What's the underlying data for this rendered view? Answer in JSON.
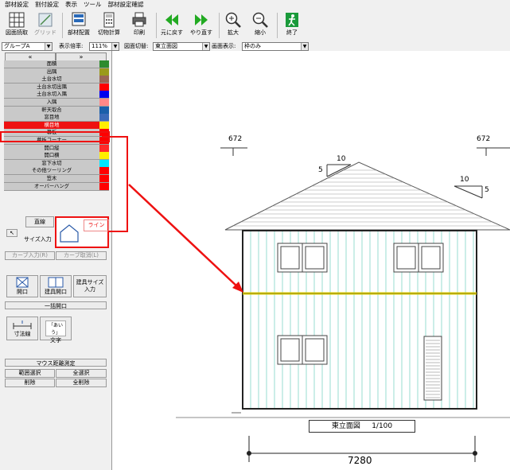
{
  "menu": [
    "部材設定",
    "割付設定",
    "表示",
    "ツール",
    "部材設定確認"
  ],
  "toolbar": {
    "load_plan": "図面読取",
    "grid": "グリッド",
    "member_place": "部材配置",
    "cut_calc": "切物計算",
    "print": "印刷",
    "undo": "元に戻す",
    "redo": "やり直す",
    "zoom_in": "拡大",
    "zoom_out": "縮小",
    "exit": "終了"
  },
  "controls": {
    "group_value": "グループA",
    "scale_label": "表示倍率:",
    "scale_value": "111%",
    "drawing_switch_label": "図面切替:",
    "drawing_switch_value": "東立面図",
    "screen_display_label": "画面表示:",
    "screen_display_value": "枠のみ"
  },
  "sidebar": {
    "prev": "«",
    "next": "»",
    "items": [
      {
        "label": "面積",
        "color": "#2e8b2e",
        "selected": false
      },
      {
        "label": "出隅",
        "color": "#9a9a1a",
        "selected": false
      },
      {
        "label": "土台水切",
        "color": "#996655",
        "selected": false
      },
      {
        "label": "土台水切出隅",
        "color": "#ff0000",
        "selected": false
      },
      {
        "label": "土台水切入隅",
        "color": "#0000ee",
        "selected": false
      },
      {
        "label": "入隅",
        "color": "#ff8888",
        "selected": false
      },
      {
        "label": "軒天取合",
        "color": "#1a5faa",
        "selected": false
      },
      {
        "label": "窓目地",
        "color": "#3a6ab8",
        "selected": false
      },
      {
        "label": "横目地",
        "color": "#ffee00",
        "selected": true
      },
      {
        "label": "幕板",
        "color": "#ff0000",
        "selected": false
      },
      {
        "label": "幕板コーナー",
        "color": "#ff0000",
        "selected": false
      },
      {
        "label": "開口縦",
        "color": "#ff2a2a",
        "selected": false
      },
      {
        "label": "開口横",
        "color": "#ffee00",
        "selected": false
      },
      {
        "label": "窓下水切",
        "color": "#00e5ff",
        "selected": false
      },
      {
        "label": "その他ツーリング",
        "color": "#ff0000",
        "selected": false
      },
      {
        "label": "笠木",
        "color": "#ff0000",
        "selected": false
      },
      {
        "label": "オーバーハング",
        "color": "#ff0000",
        "selected": false
      }
    ]
  },
  "panel": {
    "straight": "直線",
    "line": "ライン",
    "size_input": "サイズ入力",
    "curve_input": "カーブ入力(R)",
    "curve_cancel": "カーブ取消(L)",
    "opening": "開口",
    "fitting_opening": "建具開口",
    "fitting_size_input": "建具サイズ入力",
    "bulk_opening": "一括開口",
    "dimension_line": "寸法線",
    "text": "文字",
    "text_icon_sample": "「あいう」",
    "mouse_distance": "マウス距離測定",
    "range_select": "範囲選択",
    "select_all": "全選択",
    "delete": "削除",
    "delete_all": "全削除"
  },
  "drawing": {
    "dim_left": "672",
    "dim_right": "672",
    "pitch_left_rise": "10",
    "pitch_left_run": "5",
    "pitch_right_rise": "10",
    "pitch_right_run": "5",
    "title": "東立面図",
    "scale": "1/100",
    "bottom_dim": "7280"
  },
  "colors": {
    "highlight_red": "#ee1111",
    "siding_line": "#7ed6c6",
    "horizontal_joint": "#e6d400"
  }
}
